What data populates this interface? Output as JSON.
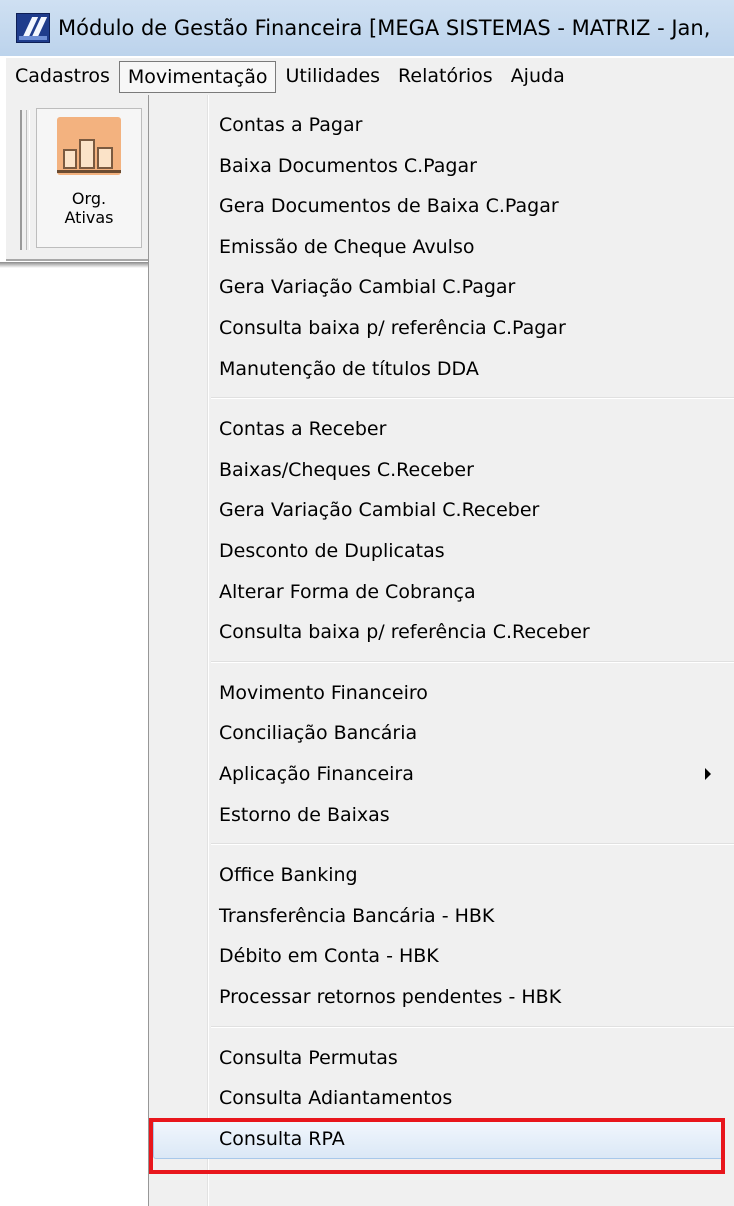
{
  "window": {
    "title": "Módulo de Gestão Financeira [MEGA SISTEMAS - MATRIZ - Jan,"
  },
  "menubar": {
    "items": [
      {
        "label": "Cadastros"
      },
      {
        "label": "Movimentação",
        "active": true
      },
      {
        "label": "Utilidades"
      },
      {
        "label": "Relatórios"
      },
      {
        "label": "Ajuda"
      }
    ]
  },
  "toolbar": {
    "org_button": {
      "line1": "Org.",
      "line2": "Ativas",
      "icon": "org-buildings-icon"
    }
  },
  "dropdown": {
    "groups": [
      [
        "Contas a Pagar",
        "Baixa Documentos C.Pagar",
        "Gera Documentos de Baixa C.Pagar",
        "Emissão de Cheque Avulso",
        "Gera Variação Cambial C.Pagar",
        "Consulta baixa p/ referência C.Pagar",
        "Manutenção de títulos DDA"
      ],
      [
        "Contas a Receber",
        "Baixas/Cheques C.Receber",
        "Gera Variação Cambial C.Receber",
        "Desconto de Duplicatas",
        "Alterar Forma de Cobrança",
        "Consulta baixa p/ referência C.Receber"
      ],
      [
        "Movimento Financeiro",
        "Conciliação Bancária",
        "Aplicação Financeira",
        "Estorno de Baixas"
      ],
      [
        "Office Banking",
        "Transferência Bancária - HBK",
        "Débito em Conta - HBK",
        "Processar retornos pendentes - HBK"
      ],
      [
        "Consulta Permutas",
        "Consulta Adiantamentos",
        "Consulta RPA"
      ]
    ],
    "submenu_item": "Aplicação Financeira",
    "highlighted_item": "Consulta Adiantamentos"
  },
  "colors": {
    "highlight_border": "#e8161c",
    "hover_fill": "#dbe8f6",
    "menu_bg": "#f0f0f0",
    "titlebar_bg": "#c4d8ee"
  }
}
